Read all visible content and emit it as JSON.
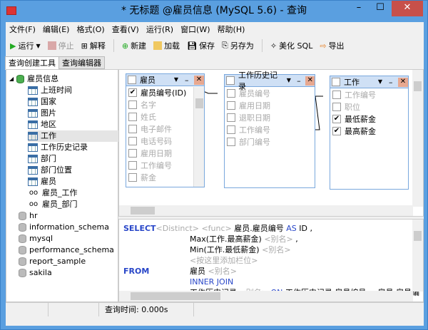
{
  "window": {
    "title": "* 无标题 @雇员信息 (MySQL 5.6) - 查询",
    "minimize": "–",
    "maximize": "☐",
    "close": "✕"
  },
  "menu": [
    "文件(F)",
    "编辑(E)",
    "格式(O)",
    "查看(V)",
    "运行(R)",
    "窗口(W)",
    "帮助(H)"
  ],
  "toolbar": {
    "run": "运行",
    "stop": "停止",
    "explain": "解释",
    "new": "新建",
    "load": "加载",
    "save": "保存",
    "save_as": "另存为",
    "beautify": "美化 SQL",
    "export": "导出"
  },
  "tabs": [
    "查询创建工具",
    "查询编辑器"
  ],
  "tree": {
    "database": "雇员信息",
    "tables": [
      "上班时间",
      "国家",
      "图片",
      "地区",
      "工作",
      "工作历史记录",
      "部门",
      "部门位置",
      "雇员"
    ],
    "selected": "工作",
    "views": [
      "雇员_工作",
      "雇员_部门"
    ],
    "other_databases": [
      "hr",
      "information_schema",
      "mysql",
      "performance_schema",
      "report_sample",
      "sakila"
    ]
  },
  "diagram": {
    "tables": [
      {
        "name": "雇员",
        "fields": [
          {
            "n": "雇员编号(ID)",
            "c": true
          },
          {
            "n": "名字",
            "c": false
          },
          {
            "n": "姓氏",
            "c": false
          },
          {
            "n": "电子邮件",
            "c": false
          },
          {
            "n": "电话号码",
            "c": false
          },
          {
            "n": "雇用日期",
            "c": false
          },
          {
            "n": "工作编号",
            "c": false
          },
          {
            "n": "薪金",
            "c": false
          }
        ]
      },
      {
        "name": "工作历史记录",
        "fields": [
          {
            "n": "雇员编号",
            "c": false
          },
          {
            "n": "雇用日期",
            "c": false
          },
          {
            "n": "退职日期",
            "c": false
          },
          {
            "n": "工作编号",
            "c": false
          },
          {
            "n": "部门编号",
            "c": false
          }
        ]
      },
      {
        "name": "工作",
        "fields": [
          {
            "n": "工作编号",
            "c": false
          },
          {
            "n": "职位",
            "c": false
          },
          {
            "n": "最低薪金",
            "c": true
          },
          {
            "n": "最高薪金",
            "c": true
          }
        ]
      }
    ]
  },
  "sql": {
    "select": "SELECT",
    "distinct": "<Distinct>",
    "func": "<func>",
    "col1": "雇员.雇员编号",
    "as": "AS",
    "id": "ID ,",
    "col2": "Max(工作.最高薪金)",
    "alias": "<别名>",
    "comma": ",",
    "col3": "Min(工作.最低薪金)",
    "add_col": "<按这里添加栏位>",
    "from": "FROM",
    "t1": "雇员",
    "join": "INNER JOIN",
    "t2": "工作历史记录",
    "on": "ON",
    "cond1": "工作历史记录.雇员编号",
    "eq": "=",
    "cond2": "雇员.雇员编"
  },
  "status": {
    "query_time": "查询时间: 0.000s"
  },
  "colors": {
    "frame": "#5a9fe0",
    "keyword": "#2846c8"
  }
}
